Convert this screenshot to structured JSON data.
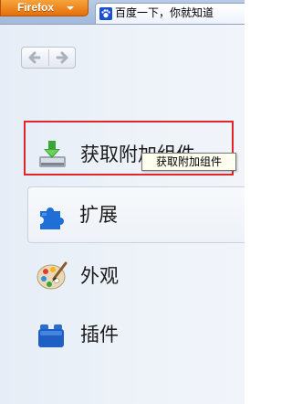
{
  "browser": {
    "menu_button_label": "Firefox",
    "tab_title": "百度一下，你就知道"
  },
  "sidebar": {
    "nav": {
      "back_glyph": "🡐",
      "forward_glyph": "🡒"
    },
    "categories": [
      {
        "label": "获取附加组件",
        "icon": "download-addons-icon",
        "highlighted": true
      },
      {
        "label": "扩展",
        "icon": "puzzle-piece-icon",
        "selected": true
      },
      {
        "label": "外观",
        "icon": "paint-palette-icon"
      },
      {
        "label": "插件",
        "icon": "lego-brick-icon"
      }
    ],
    "tooltip": "获取附加组件"
  },
  "colors": {
    "firefox_orange": "#e56f0a",
    "highlight_red": "#e0262b",
    "extension_blue": "#1f6fd6",
    "download_green": "#3aa63a"
  }
}
